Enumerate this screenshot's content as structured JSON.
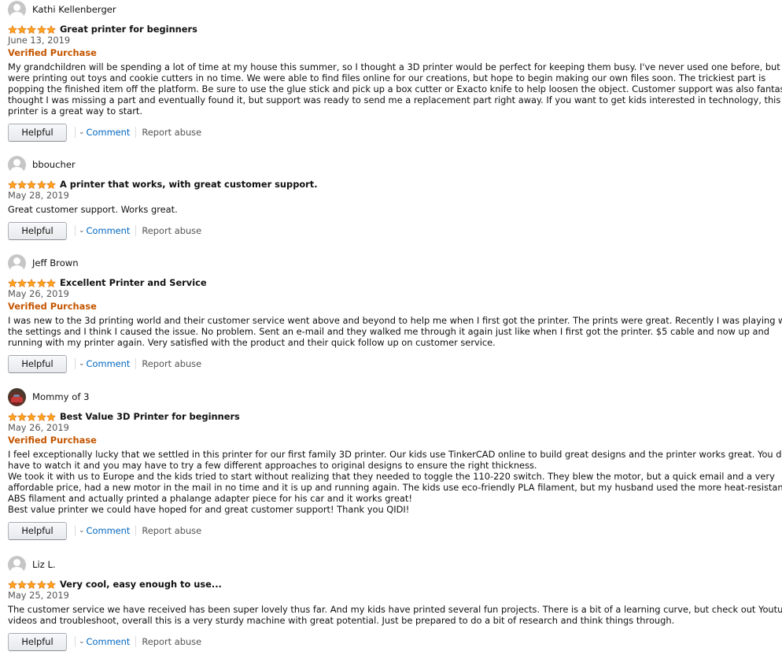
{
  "colors": {
    "star": "#ffa41c",
    "star_outline": "#de7921",
    "verified": "#c45500",
    "link": "#0066c0"
  },
  "rating_icon": "five-star-icon",
  "reviews": [
    {
      "name": "Kathi Kellenberger",
      "avatar": "default",
      "rating": 5,
      "title": "Great printer for beginners",
      "date": "June 13, 2019",
      "verified": "Verified Purchase",
      "body": [
        "My grandchildren will be spending a lot of time at my house this summer, so I thought a 3D printer would be perfect for keeping them busy. I've never used one before, but we",
        "were printing out toys and cookie cutters in no time. We were able to find files online for our creations, but hope to begin making our own files soon. The trickiest part is",
        "popping the finished item off the platform. Be sure to use the glue stick and pick up a box cutter or Exacto knife to help loosen the object. Customer support was also fantastic. I",
        "thought I was missing a part and eventually found it, but support was ready to send me a replacement part right away. If you want to get kids interested in technology, this",
        "printer is a great way to start."
      ],
      "helpful": "Helpful",
      "comment": "Comment",
      "report": "Report abuse"
    },
    {
      "name": "bboucher",
      "avatar": "default",
      "rating": 5,
      "title": "A printer that works, with great customer support.",
      "date": "May 28, 2019",
      "verified": "",
      "body": [
        "Great customer support. Works great."
      ],
      "helpful": "Helpful",
      "comment": "Comment",
      "report": "Report abuse"
    },
    {
      "name": "Jeff Brown",
      "avatar": "default",
      "rating": 5,
      "title": "Excellent Printer and Service",
      "date": "May 26, 2019",
      "verified": "Verified Purchase",
      "body": [
        "I was new to the 3d printing world and their customer service went above and beyond to help me when I first got the printer. The prints were great. Recently I was playing with",
        "the settings and I think I caused the issue. No problem. Sent an e-mail and they walked me through it again just like when I first got the printer. $5 cable and now up and",
        "running with my printer again. Very satisfied with the product and their quick follow up on customer service."
      ],
      "helpful": "Helpful",
      "comment": "Comment",
      "report": "Report abuse"
    },
    {
      "name": "Mommy of 3",
      "avatar": "photo",
      "rating": 5,
      "title": "Best Value 3D Printer for beginners",
      "date": "May 26, 2019",
      "verified": "Verified Purchase",
      "body": [
        "I feel exceptionally lucky that we settled in this printer for our first family 3D printer. Our kids use TinkerCAD online to build great designs and the printer works great. You do",
        "have to watch it and you may have to try a few different approaches to original designs to ensure the right thickness.",
        "We took it with us to Europe and the kids tried to start without realizing that they needed to toggle the 110-220 switch. They blew the motor, but a quick email and a very",
        "affordable price, had a new motor in the mail in no time and it is up and running again. The kids use eco-friendly PLA filament, but my husband used the more heat-resistant",
        "ABS filament and actually printed a phalange adapter piece for his car and it works great!",
        "Best value printer we could have hoped for and great customer support! Thank you QIDI!"
      ],
      "helpful": "Helpful",
      "comment": "Comment",
      "report": "Report abuse"
    },
    {
      "name": "Liz L.",
      "avatar": "default",
      "rating": 5,
      "title": "Very cool, easy enough to use...",
      "date": "May 25, 2019",
      "verified": "",
      "body": [
        "The customer service we have received has been super lovely thus far. And my kids have printed several fun projects. There is a bit of a learning curve, but check out Youtube",
        "videos and troubleshoot, overall this is a very sturdy machine with great potential. Just be prepared to do a bit of research and think things through."
      ],
      "helpful": "Helpful",
      "comment": "Comment",
      "report": "Report abuse"
    }
  ]
}
